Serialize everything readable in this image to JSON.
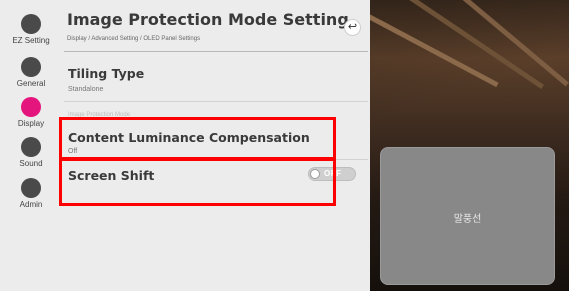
{
  "nav": {
    "items": [
      {
        "label": "EZ Setting",
        "active": false
      },
      {
        "label": "General",
        "active": false
      },
      {
        "label": "Display",
        "active": true
      },
      {
        "label": "Sound",
        "active": false
      },
      {
        "label": "Admin",
        "active": false
      }
    ]
  },
  "header": {
    "title": "Image Protection Mode Setting",
    "breadcrumb": "Display / Advanced Setting / OLED Panel Settings",
    "back_icon": "↩"
  },
  "settings": {
    "tiling_type": {
      "title": "Tiling Type",
      "value": "Standalone"
    },
    "faint_label": "Image Protection Mode",
    "content_luminance": {
      "title": "Content Luminance Compensation",
      "value": "Off"
    },
    "screen_shift": {
      "title": "Screen Shift",
      "toggle_label": "OFF",
      "toggle_state": "off"
    }
  },
  "preview": {
    "bubble_text": "말풍선"
  },
  "colors": {
    "accent": "#e4157c",
    "highlight": "#ff0000",
    "panel_bg": "#ececec"
  }
}
